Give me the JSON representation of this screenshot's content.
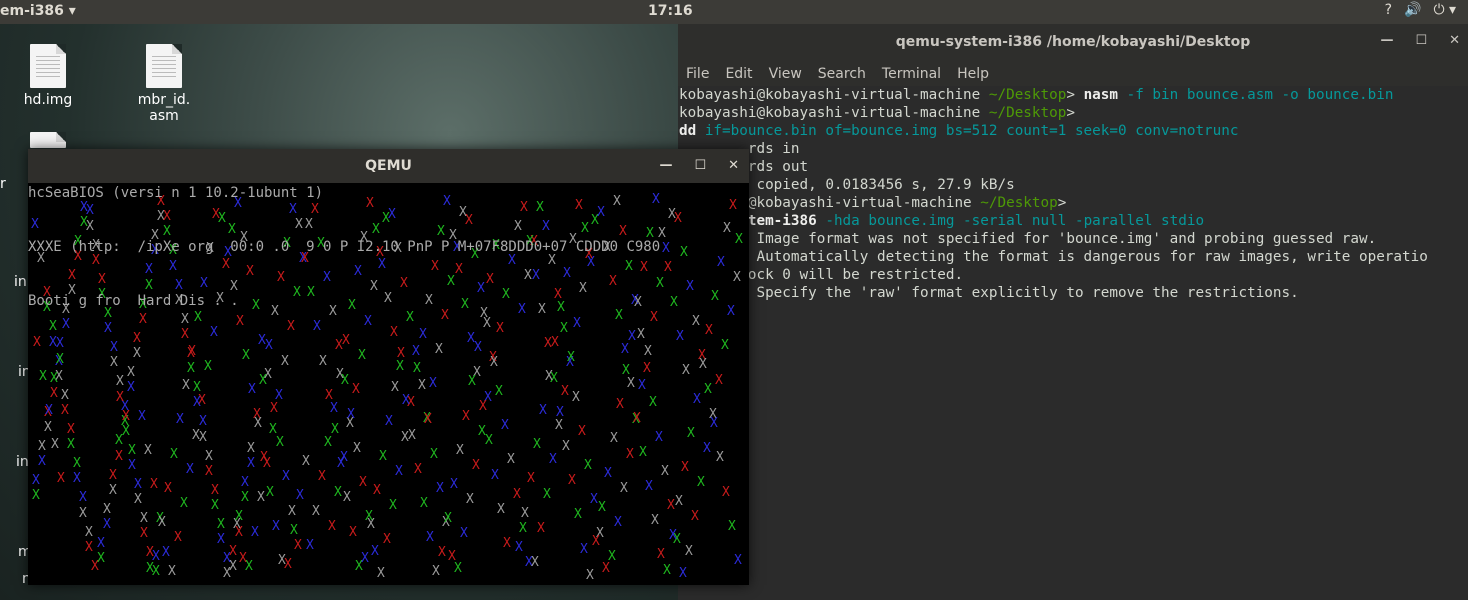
{
  "topbar": {
    "app_name": "em-i386 ▾",
    "clock": "17:16",
    "tray": [
      "?",
      "🔊",
      "⏻ ▾"
    ]
  },
  "desktop": {
    "icons": [
      {
        "name": "hd.img"
      },
      {
        "name": "mbr_id.\nasm"
      }
    ],
    "edge_labels": [
      "r",
      "in",
      "in",
      "in",
      "m",
      "n"
    ]
  },
  "terminal": {
    "title": "qemu-system-i386  /home/kobayashi/Desktop",
    "menu": [
      "File",
      "Edit",
      "View",
      "Search",
      "Terminal",
      "Help"
    ],
    "lines": [
      {
        "user": "kobayashi@kobayashi-virtual-machine",
        "path": " ~/Desktop",
        "prompt": "> ",
        "cmd": "nasm",
        "args": " -f bin bounce.asm -o bounce.bin"
      },
      {
        "user": "kobayashi@kobayashi-virtual-machine",
        "path": " ~/Desktop",
        "prompt": ">",
        "cmd": "",
        "args": ""
      },
      {
        "user": "",
        "path": "",
        "prompt": "",
        "cmd": "dd",
        "args": " if=bounce.bin of=bounce.img bs=512 count=1 seek=0 conv=notrunc"
      },
      {
        "plain": "        rds in"
      },
      {
        "plain": "        rds out"
      },
      {
        "plain": "       s copied, 0.0183456 s, 27.9 kB/s"
      },
      {
        "user": "       i@kobayashi-virtual-machine",
        "path": " ~/Desktop",
        "prompt": ">",
        "cmd": "",
        "args": ""
      },
      {
        "user": "",
        "path": "",
        "prompt": "",
        "cmd": "       stem-i386",
        "args": " -hda bounce.img -serial null -parallel stdio"
      },
      {
        "plain": "         Image format was not specified for 'bounce.img' and probing guessed raw."
      },
      {
        "plain": "         Automatically detecting the format is dangerous for raw images, write operatio"
      },
      {
        "plain": "        ock 0 will be restricted."
      },
      {
        "plain": "         Specify the 'raw' format explicitly to remove the restrictions."
      }
    ]
  },
  "qemu": {
    "title": "QEMU",
    "bios_lines": [
      "hcSeaBIOS (versi n 1 10.2-1ubunt 1)",
      "",
      "",
      "XXXE (http:  /ipXe org  00:0 .0  9 0 P I2.10 PnP P M+07F8DDD0+07 CDDD0 C980",
      "",
      "",
      "Booti g fro  Hard Dis . ."
    ],
    "colors": {
      "red": "#c71b1b",
      "green": "#1fb51f",
      "blue": "#2b2bd8",
      "gray": "#9a9a9a"
    }
  }
}
